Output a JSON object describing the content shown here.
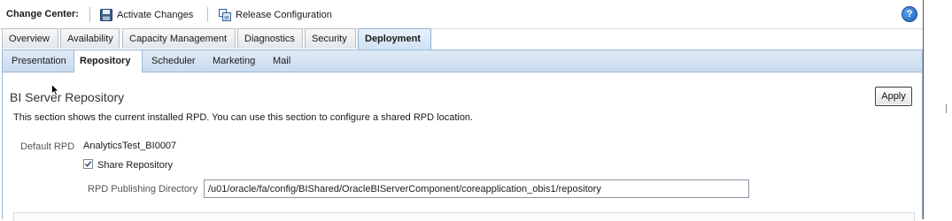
{
  "change_center": {
    "label": "Change Center:",
    "activate_label": "Activate Changes",
    "release_label": "Release Configuration",
    "help_symbol": "?"
  },
  "top_tabs": [
    {
      "label": "Overview"
    },
    {
      "label": "Availability"
    },
    {
      "label": "Capacity Management"
    },
    {
      "label": "Diagnostics"
    },
    {
      "label": "Security"
    },
    {
      "label": "Deployment",
      "active": true
    }
  ],
  "sub_tabs": [
    {
      "label": "Presentation"
    },
    {
      "label": "Repository",
      "active": true
    },
    {
      "label": "Scheduler"
    },
    {
      "label": "Marketing"
    },
    {
      "label": "Mail"
    }
  ],
  "section": {
    "title": "BI Server Repository",
    "apply_label": "Apply",
    "description": "This section shows the current installed RPD. You can use this section to configure a shared RPD location."
  },
  "form": {
    "default_rpd_label": "Default RPD",
    "default_rpd_value": "AnalyticsTest_BI0007",
    "share_repository_label": "Share Repository",
    "share_repository_checked": true,
    "publishing_dir_label": "RPD Publishing Directory",
    "publishing_dir_value": "/u01/oracle/fa/config/BIShared/OracleBIServerComponent/coreapplication_obis1/repository"
  },
  "icons": {
    "activate": "save-disk-icon",
    "release": "release-configuration-icon",
    "help": "help-icon",
    "checkbox": "checkmark-icon"
  },
  "colors": {
    "active_tab": "#cfe2f5",
    "tab_band": "#c9dbee",
    "help_blue": "#1d5fb8"
  }
}
